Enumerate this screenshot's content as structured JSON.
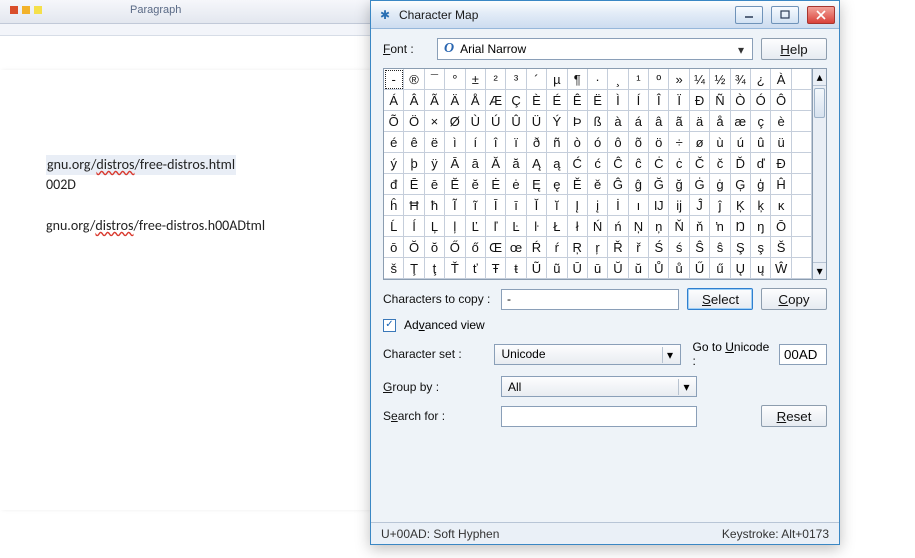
{
  "word": {
    "paragraph_label": "Paragraph",
    "line1_url": "gnu.org/distros/free-distros.html",
    "line2_code": "002D",
    "line3_url_a": "gnu.org/",
    "line3_url_b": "distros",
    "line3_url_c": "/free-distros.h00ADtml"
  },
  "charmap": {
    "title": "Character Map",
    "font_label": "Font :",
    "font_value": "Arial Narrow",
    "help_label": "Help",
    "grid": [
      [
        "-",
        "®",
        "¯",
        "°",
        "±",
        "²",
        "³",
        "´",
        "µ",
        "¶",
        "·",
        "¸",
        "¹",
        "º",
        "»",
        "¼",
        "½",
        "¾",
        "¿",
        "À"
      ],
      [
        "Á",
        "Â",
        "Ã",
        "Ä",
        "Å",
        "Æ",
        "Ç",
        "È",
        "É",
        "Ê",
        "Ë",
        "Ì",
        "Í",
        "Î",
        "Ï",
        "Ð",
        "Ñ",
        "Ò",
        "Ó",
        "Ô"
      ],
      [
        "Õ",
        "Ö",
        "×",
        "Ø",
        "Ù",
        "Ú",
        "Û",
        "Ü",
        "Ý",
        "Þ",
        "ß",
        "à",
        "á",
        "â",
        "ã",
        "ä",
        "å",
        "æ",
        "ç",
        "è"
      ],
      [
        "é",
        "ê",
        "ë",
        "ì",
        "í",
        "î",
        "ï",
        "ð",
        "ñ",
        "ò",
        "ó",
        "ô",
        "õ",
        "ö",
        "÷",
        "ø",
        "ù",
        "ú",
        "û",
        "ü"
      ],
      [
        "ý",
        "þ",
        "ÿ",
        "Ā",
        "ā",
        "Ă",
        "ă",
        "Ą",
        "ą",
        "Ć",
        "ć",
        "Ĉ",
        "ĉ",
        "Ċ",
        "ċ",
        "Č",
        "č",
        "Ď",
        "ď",
        "Đ"
      ],
      [
        "đ",
        "Ē",
        "ē",
        "Ĕ",
        "ĕ",
        "Ė",
        "ė",
        "Ę",
        "ę",
        "Ě",
        "ě",
        "Ĝ",
        "ĝ",
        "Ğ",
        "ğ",
        "Ġ",
        "ġ",
        "Ģ",
        "ģ",
        "Ĥ"
      ],
      [
        "ĥ",
        "Ħ",
        "ħ",
        "Ĩ",
        "ĩ",
        "Ī",
        "ī",
        "Ĭ",
        "ĭ",
        "Į",
        "į",
        "İ",
        "ı",
        "Ĳ",
        "ĳ",
        "Ĵ",
        "ĵ",
        "Ķ",
        "ķ",
        "ĸ"
      ],
      [
        "Ĺ",
        "ĺ",
        "Ļ",
        "ļ",
        "Ľ",
        "ľ",
        "Ŀ",
        "ŀ",
        "Ł",
        "ł",
        "Ń",
        "ń",
        "Ņ",
        "ņ",
        "Ň",
        "ň",
        "ŉ",
        "Ŋ",
        "ŋ",
        "Ō"
      ],
      [
        "ō",
        "Ŏ",
        "ŏ",
        "Ő",
        "ő",
        "Œ",
        "œ",
        "Ŕ",
        "ŕ",
        "Ŗ",
        "ŗ",
        "Ř",
        "ř",
        "Ś",
        "ś",
        "Ŝ",
        "ŝ",
        "Ş",
        "ş",
        "Š"
      ],
      [
        "š",
        "Ţ",
        "ţ",
        "Ť",
        "ť",
        "Ŧ",
        "ŧ",
        "Ũ",
        "ũ",
        "Ū",
        "ū",
        "Ŭ",
        "ŭ",
        "Ů",
        "ů",
        "Ű",
        "ű",
        "Ų",
        "ų",
        "Ŵ"
      ]
    ],
    "selected_index": 0,
    "copy_label": "Characters to copy :",
    "copy_value": "-",
    "select_btn": "Select",
    "copy_btn": "Copy",
    "adv_label": "Advanced view",
    "charset_label": "Character set :",
    "charset_value": "Unicode",
    "goto_label": "Go to Unicode :",
    "goto_value": "00AD",
    "group_label": "Group by :",
    "group_value": "All",
    "search_label": "Search for :",
    "search_value": "",
    "reset_btn": "Reset",
    "status_left": "U+00AD: Soft Hyphen",
    "status_right": "Keystroke: Alt+0173"
  }
}
